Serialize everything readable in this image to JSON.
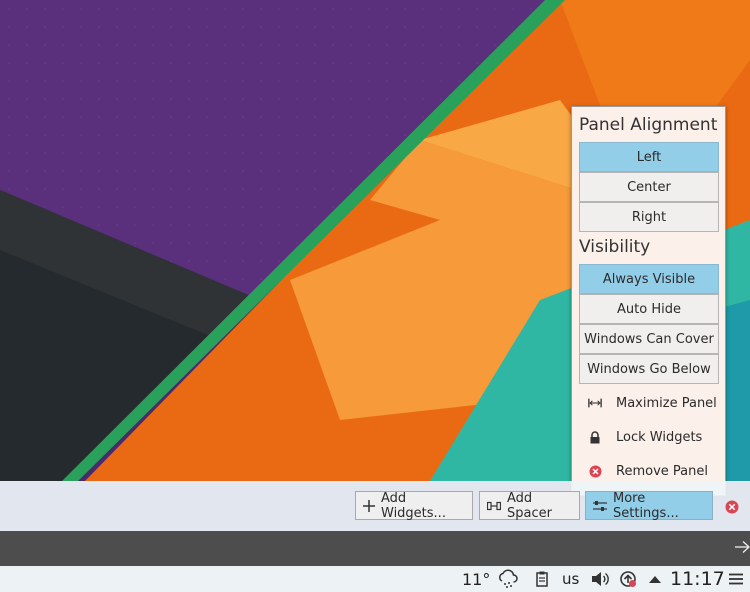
{
  "popup": {
    "alignment_title": "Panel Alignment",
    "alignment_options": [
      "Left",
      "Center",
      "Right"
    ],
    "alignment_selected": "Left",
    "visibility_title": "Visibility",
    "visibility_options": [
      "Always Visible",
      "Auto Hide",
      "Windows Can Cover",
      "Windows Go Below"
    ],
    "visibility_selected": "Always Visible",
    "actions": {
      "maximize": "Maximize Panel",
      "lock": "Lock Widgets",
      "remove": "Remove Panel"
    }
  },
  "toolbar": {
    "add_widgets": "Add Widgets...",
    "add_spacer": "Add Spacer",
    "more_settings": "More Settings..."
  },
  "taskbar": {
    "temperature": "11°",
    "keyboard_layout": "us",
    "clock": "11:17"
  },
  "colors": {
    "selected": "#93cee9",
    "popup_bg": "#fbf0ea",
    "close_red": "#da4453"
  }
}
